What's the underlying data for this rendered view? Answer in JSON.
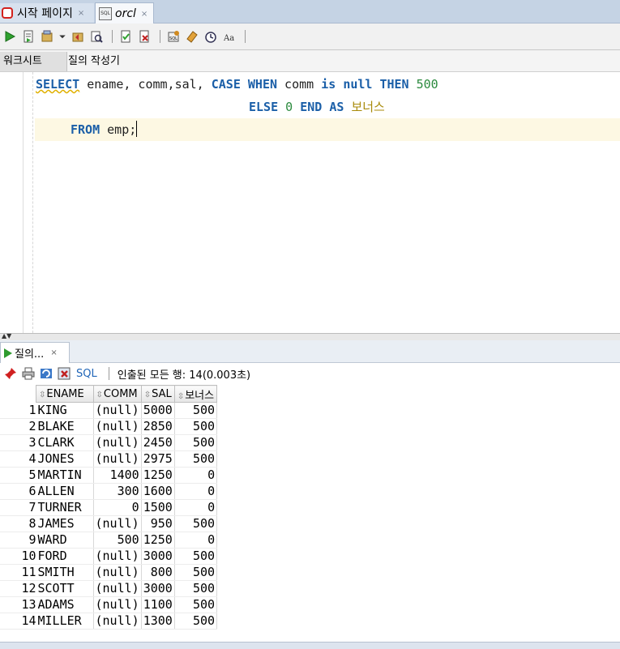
{
  "doc_tabs": [
    {
      "label": "시작 페이지",
      "close": "×"
    },
    {
      "label": "orcl",
      "close": "×"
    }
  ],
  "worksheet_tabs": [
    "워크시트",
    "질의 작성기"
  ],
  "editor": {
    "line1": {
      "select": "SELECT",
      "cols": " ename, comm,sal, ",
      "case": "CASE",
      "when": "WHEN",
      "comm": " comm ",
      "is": "is",
      "null": "null",
      "then": "THEN",
      "v500": "500"
    },
    "line2": {
      "else": "ELSE",
      "v0": "0",
      "end": "END",
      "as": "AS",
      "alias": "보너스"
    },
    "line3": {
      "from": "FROM",
      "rest": " emp;"
    }
  },
  "results_tab": {
    "label": "질의...",
    "close": "×"
  },
  "results_toolbar": {
    "sql_link": "SQL",
    "status": "인출된 모든 행: 14(0.003초)"
  },
  "grid": {
    "columns": [
      "ENAME",
      "COMM",
      "SAL",
      "보너스"
    ],
    "rows": [
      {
        "n": "1",
        "ename": "KING",
        "comm": "(null)",
        "sal": "5000",
        "bonus": "500"
      },
      {
        "n": "2",
        "ename": "BLAKE",
        "comm": "(null)",
        "sal": "2850",
        "bonus": "500"
      },
      {
        "n": "3",
        "ename": "CLARK",
        "comm": "(null)",
        "sal": "2450",
        "bonus": "500"
      },
      {
        "n": "4",
        "ename": "JONES",
        "comm": "(null)",
        "sal": "2975",
        "bonus": "500"
      },
      {
        "n": "5",
        "ename": "MARTIN",
        "comm": "1400",
        "sal": "1250",
        "bonus": "0"
      },
      {
        "n": "6",
        "ename": "ALLEN",
        "comm": "300",
        "sal": "1600",
        "bonus": "0"
      },
      {
        "n": "7",
        "ename": "TURNER",
        "comm": "0",
        "sal": "1500",
        "bonus": "0"
      },
      {
        "n": "8",
        "ename": "JAMES",
        "comm": "(null)",
        "sal": "950",
        "bonus": "500"
      },
      {
        "n": "9",
        "ename": "WARD",
        "comm": "500",
        "sal": "1250",
        "bonus": "0"
      },
      {
        "n": "10",
        "ename": "FORD",
        "comm": "(null)",
        "sal": "3000",
        "bonus": "500"
      },
      {
        "n": "11",
        "ename": "SMITH",
        "comm": "(null)",
        "sal": "800",
        "bonus": "500"
      },
      {
        "n": "12",
        "ename": "SCOTT",
        "comm": "(null)",
        "sal": "3000",
        "bonus": "500"
      },
      {
        "n": "13",
        "ename": "ADAMS",
        "comm": "(null)",
        "sal": "1100",
        "bonus": "500"
      },
      {
        "n": "14",
        "ename": "MILLER",
        "comm": "(null)",
        "sal": "1300",
        "bonus": "500"
      }
    ]
  },
  "colors": {
    "keyword": "#1b5fa8",
    "number": "#2b8a3e",
    "alias": "#a88a0a",
    "current_line": "#fdf8e3"
  }
}
